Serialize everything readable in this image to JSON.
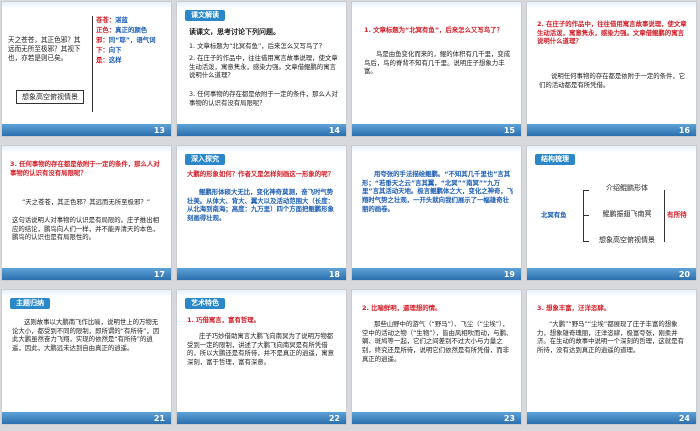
{
  "slides": [
    {
      "number": "13",
      "left_text": "天之苍苍，其正色邪？其远而无所至极邪？其视下也，亦若是则已矣。",
      "frame_text": "想象高空俯视情景",
      "right_items": [
        {
          "a": "苍苍：",
          "b": "湛蓝"
        },
        {
          "a": "正色：",
          "b": "真正的颜色"
        },
        {
          "a": "邪：",
          "b": "同“耶”，语气词"
        },
        {
          "a": "下：",
          "b": "向下"
        },
        {
          "a": "是：",
          "b": "这样"
        }
      ]
    },
    {
      "number": "14",
      "tag": "课文解读",
      "intro": "读课文，思考讨论下列问题。",
      "q1": "1. 文章标题为“北冥有鱼”，后来怎么又写鸟了？",
      "q2": "2. 在庄子的作品中，往往借用寓言故事说理，使文章生动活泼，寓意隽永，感染力强。文章借鲲鹏的寓言说明什么道理？",
      "q3": "3. 任何事物的存在都是依附于一定的条件，那么人对事物的认识有没有局限呢？"
    },
    {
      "number": "15",
      "heading": "1. 文章标题为“北冥有鱼”，后来怎么又写鸟了？",
      "body": "鸟是由鱼变化而来的，鲲的体积有几千里，变成鸟后，鸟的脊背不知有几千里。说明庄子想象力丰富。"
    },
    {
      "number": "16",
      "heading": "2. 在庄子的作品中，往往借用寓言故事说理，使文章生动活泼，寓意隽永，感染力强。文章借鲲鹏的寓言说明什么道理？",
      "body": "说明任何事物的存在都是依附于一定的条件，它们的活动都是有所凭借。"
    },
    {
      "number": "17",
      "heading": "3. 任何事物的存在都是依附于一定的条件，那么人对事物的认识有没有局限呢？",
      "quote": "“天之苍苍，其正色邪？其远而无所至极邪？”",
      "body": "这句话说明人对事物的认识是有局限的。庄子推出相应的结论，鹏鸟向人们一样，并不能弄清天的本色，鹏鸟的认识也是有局限性的。"
    },
    {
      "number": "18",
      "tag": "深入探究",
      "question": "大鹏的形象如何？作者又是怎样刻画这一形象的呢？",
      "body": "鲲鹏形体硕大无比，变化神奇莫测，奋飞时气势壮美。从体大、背大、翼大以及活动范围大（长度：从北海到南海；高度：九万里）四个方面把鲲鹏形象刻画得壮观。"
    },
    {
      "number": "19",
      "body": "用夸张的手法描绘鲲鹏。“不知其几千里也”言其形；“若垂天之云”言其翼，“北冥”“南冥”“九万里”言其活动天地。极言鲲鹏体之大，变化之神奇，飞翔时气势之壮观，一开头就向我们展示了一幅雄奇壮丽的画卷。"
    },
    {
      "number": "20",
      "tag": "结构梳理",
      "left_label": "北冥有鱼",
      "branches": [
        "介绍鲲鹏形体",
        "鲲鹏振翅飞南冥",
        "想象高空俯视情景"
      ],
      "right_label": "有所待"
    },
    {
      "number": "21",
      "tag": "主题归纳",
      "body": "这则故事以大鹏南飞作比喻，说明世上的万物无论大小，都受到不同的限制，即所谓的“有所待”，因此大鹏虽然奋力飞翔，实现的依然是“有所待”的逍遥，因此，大鹏远未达到自由真正的逍遥。"
    },
    {
      "number": "22",
      "tag": "艺术特色",
      "heading": "1. 巧借寓言，富有哲理。",
      "body": "庄子巧妙借助寓言大鹏飞向南冥为了说明万物都受到一定的限制，讲述了大鹏飞向南冥是有所凭借的，所以大鹏还是有所待，并不是真正的逍遥，寓意深刻，富于哲理，富有深意。"
    },
    {
      "number": "23",
      "heading": "2. 比喻鲜明，逼理想的情。",
      "body": "那些山野中的游气（“野马”）、飞尘（“尘埃”），空中的活动之物（“生物”），皆由风相吹而动，与鹏、蜩、斑鸠等一起，它们之间差别不过大小与力量之别，终究还是所待，说明它们依然是有所凭借，而非真正的逍遥。"
    },
    {
      "number": "24",
      "heading": "3. 想象丰富，汪洋恣肆。",
      "body": "“大鹏”“野马”“尘埃”都展现了庄子丰富的想象力，想象雄奇瑰丽，汪洋恣肆，极富夸张，刚柔并济。在生动的故事中说明一个深刻的哲理，这就是有所待，没有达到真正的逍遥的道理。"
    }
  ]
}
